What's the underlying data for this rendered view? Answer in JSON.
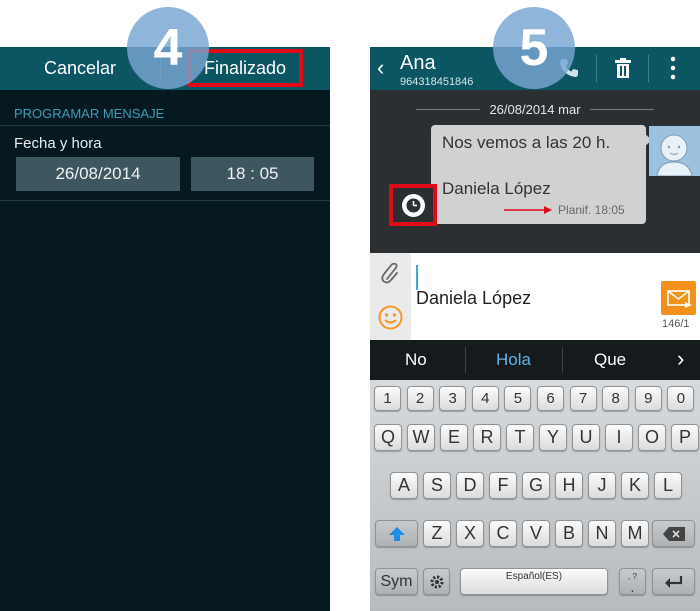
{
  "step4": {
    "number": "4",
    "cancel": "Cancelar",
    "done": "Finalizado",
    "section": "PROGRAMAR MENSAJE",
    "label": "Fecha y hora",
    "date": "26/08/2014",
    "time": "18 : 05"
  },
  "step5": {
    "number": "5",
    "contact": "Ana",
    "phone": "964318451846",
    "date_header": "26/08/2014 mar",
    "message": "Nos vemos a las 20 h.",
    "signature": "Daniela López",
    "scheduled": "Planif. 18:05",
    "compose_text": "Daniela López",
    "char_count": "146/1",
    "suggestions": [
      "No",
      "Hola",
      "Que"
    ],
    "num_row": [
      "1",
      "2",
      "3",
      "4",
      "5",
      "6",
      "7",
      "8",
      "9",
      "0"
    ],
    "row1": [
      "Q",
      "W",
      "E",
      "R",
      "T",
      "Y",
      "U",
      "I",
      "O",
      "P"
    ],
    "row2": [
      "A",
      "S",
      "D",
      "F",
      "G",
      "H",
      "J",
      "K",
      "L"
    ],
    "row3": [
      "Z",
      "X",
      "C",
      "V",
      "B",
      "N",
      "M"
    ],
    "sym": "Sym",
    "space_label": "Español(ES)",
    "punct": ".",
    "punct_sub": ",  ?"
  },
  "colors": {
    "accent_red": "#e00a17",
    "header_teal": "#0c5563",
    "section_blue": "#3a9bb5",
    "suggest_blue": "#5fb3e8",
    "badge_blue": "#78a5d2",
    "send_orange": "#f2911b"
  }
}
